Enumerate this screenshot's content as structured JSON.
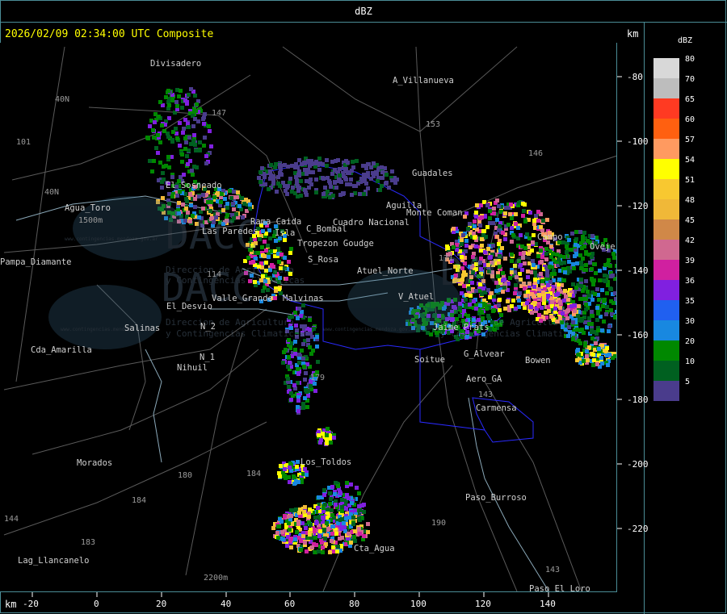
{
  "title": "dBZ",
  "timestamp": "2026/02/09 02:34:00 UTC Composite",
  "unit_top": "km",
  "unit_bottom": "km",
  "legend": {
    "title": "dBZ",
    "entries": [
      {
        "value": "80",
        "color": "#d8d8d8"
      },
      {
        "value": "70",
        "color": "#bdbdbd"
      },
      {
        "value": "65",
        "color": "#ff3a22"
      },
      {
        "value": "60",
        "color": "#ff6010"
      },
      {
        "value": "57",
        "color": "#ff9a60"
      },
      {
        "value": "54",
        "color": "#ffff00"
      },
      {
        "value": "51",
        "color": "#f8c830"
      },
      {
        "value": "48",
        "color": "#f0b838"
      },
      {
        "value": "45",
        "color": "#d08848"
      },
      {
        "value": "42",
        "color": "#d06890"
      },
      {
        "value": "39",
        "color": "#d020a0"
      },
      {
        "value": "36",
        "color": "#8020e0"
      },
      {
        "value": "35",
        "color": "#2060f0"
      },
      {
        "value": "30",
        "color": "#1888e0"
      },
      {
        "value": "20",
        "color": "#008800"
      },
      {
        "value": "10",
        "color": "#006020"
      },
      {
        "value": "5",
        "color": "#4a3c8c"
      }
    ]
  },
  "y_axis_labels": [
    "-80",
    "-100",
    "-120",
    "-140",
    "-160",
    "-180",
    "-200",
    "-220"
  ],
  "x_axis_labels": [
    "-20",
    "0",
    "20",
    "40",
    "60",
    "80",
    "100",
    "120",
    "140"
  ],
  "places": [
    {
      "name": "Divisadero"
    },
    {
      "name": "A_Villanueva"
    },
    {
      "name": "Guadales"
    },
    {
      "name": "Agua_Toro"
    },
    {
      "name": "Pampa_Diamante"
    },
    {
      "name": "El_Desvio"
    },
    {
      "name": "Valle_Grande"
    },
    {
      "name": "Salinas"
    },
    {
      "name": "Cda_Amarilla"
    },
    {
      "name": "Nihuil"
    },
    {
      "name": "S_Rosa"
    },
    {
      "name": "Atuel_Norte"
    },
    {
      "name": "V_Atuel"
    },
    {
      "name": "Soitue"
    },
    {
      "name": "Aero_GA"
    },
    {
      "name": "Carmensa"
    },
    {
      "name": "Morados"
    },
    {
      "name": "Los_Toldos"
    },
    {
      "name": "Paso_Burroso"
    },
    {
      "name": "Lag_Llancanelo"
    },
    {
      "name": "Paso_El_Loro"
    },
    {
      "name": "Cta_Agua"
    },
    {
      "name": "Malvinas"
    },
    {
      "name": "Tropezon Goudge"
    },
    {
      "name": "Cuadro Nacional"
    },
    {
      "name": "Las Paredes"
    },
    {
      "name": "Isla"
    },
    {
      "name": "C_Bombal"
    },
    {
      "name": "Rama Caida"
    },
    {
      "name": "G_Alvear"
    },
    {
      "name": "Bowen"
    },
    {
      "name": "Campo"
    },
    {
      "name": "Ovejeria"
    },
    {
      "name": "Jaime Prats"
    },
    {
      "name": "El Sosneado"
    },
    {
      "name": "N_1"
    },
    {
      "name": "N_2"
    },
    {
      "name": "Monte Coman"
    },
    {
      "name": "Aguilla"
    }
  ],
  "route_numbers": [
    "153",
    "146",
    "143",
    "171",
    "179",
    "184",
    "180",
    "183",
    "184",
    "190",
    "143",
    "147",
    "101",
    "40N",
    "40N",
    "114",
    "144"
  ],
  "elevations": [
    "1500m",
    "2200m"
  ],
  "watermark": {
    "brand": "DACC",
    "line1": "Direccion de Agricultura",
    "line2": "y Contingencias Climaticas",
    "url": "www.contingencias.mendoza.gov.ar"
  }
}
